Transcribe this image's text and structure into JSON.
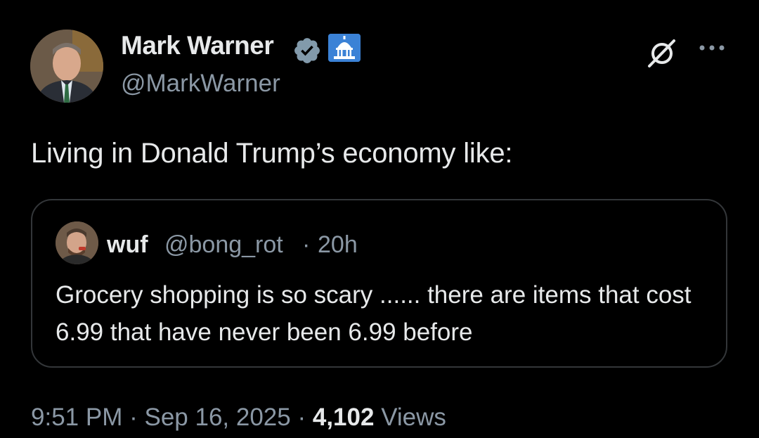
{
  "tweet": {
    "author": {
      "name": "Mark Warner",
      "handle": "@MarkWarner",
      "avatar_icon": "person-avatar",
      "verified_icon": "verified-badge-icon",
      "affiliation_icon": "capitol-building-icon"
    },
    "actions": {
      "grok_icon": "grok-icon",
      "more_icon": "more-options-icon"
    },
    "text": "Living in Donald Trump’s economy like:",
    "quote": {
      "author_name": "wuf",
      "author_handle": "@bong_rot",
      "separator": "·",
      "time": "20h",
      "text": "Grocery shopping is so scary ...... there are items that cost 6.99 that have never been 6.99 before"
    },
    "meta": {
      "time": "9:51 PM",
      "sep1": "·",
      "date": "Sep 16, 2025",
      "sep2": "·",
      "views_count": "4,102",
      "views_label": "Views"
    }
  },
  "colors": {
    "background": "#000000",
    "primary_text": "#e7e9ea",
    "secondary_text": "#8b98a5",
    "border": "#333639",
    "verified": "#829aab",
    "affiliation_badge": "#3b82d6"
  }
}
